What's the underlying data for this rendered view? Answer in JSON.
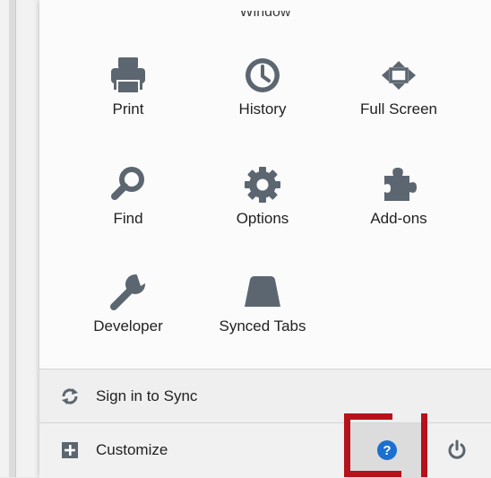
{
  "menu": {
    "section_label": "Window",
    "items": [
      {
        "label": "Print",
        "icon": "printer-icon"
      },
      {
        "label": "History",
        "icon": "clock-icon"
      },
      {
        "label": "Full Screen",
        "icon": "full-screen-icon"
      },
      {
        "label": "Find",
        "icon": "magnifier-icon"
      },
      {
        "label": "Options",
        "icon": "gear-icon"
      },
      {
        "label": "Add-ons",
        "icon": "puzzle-piece-icon"
      },
      {
        "label": "Developer",
        "icon": "wrench-icon"
      },
      {
        "label": "Synced Tabs",
        "icon": "synced-tabs-icon"
      }
    ]
  },
  "footer": {
    "sync_label": "Sign in to Sync",
    "customize_label": "Customize"
  },
  "colors": {
    "icon_gray": "#5c6670",
    "help_blue": "#1b6fd1",
    "annotation_red": "#b5121b"
  }
}
